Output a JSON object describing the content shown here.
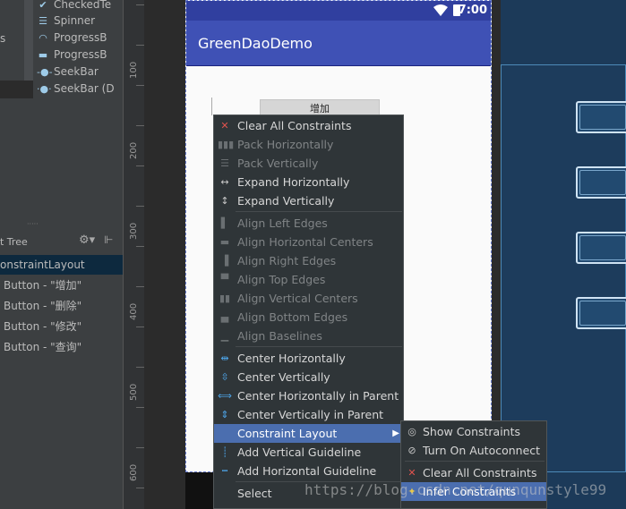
{
  "palette": {
    "items": [
      {
        "icon": "checkbox-icon",
        "label": "CheckedTe"
      },
      {
        "icon": "spinner-icon",
        "label": "Spinner"
      },
      {
        "icon": "progressbar-icon",
        "label": "ProgressB"
      },
      {
        "icon": "progressbar-horizontal-icon",
        "label": "ProgressB"
      },
      {
        "icon": "seekbar-icon",
        "label": "SeekBar"
      },
      {
        "icon": "seekbar-discrete-icon",
        "label": "SeekBar (D"
      }
    ],
    "left_fragment": "s"
  },
  "component_tree": {
    "title": "t Tree",
    "root": "onstraintLayout",
    "children": [
      "Button - \"增加\"",
      "Button - \"删除\"",
      "Button - \"修改\"",
      "Button - \"查询\""
    ]
  },
  "ruler": {
    "labels": [
      "100",
      "200",
      "300",
      "400",
      "500",
      "600"
    ]
  },
  "phone": {
    "time": "7:00",
    "app_title": "GreenDaoDemo",
    "button_fragment": "增加"
  },
  "context_menu": {
    "items": [
      {
        "icon": "clear-constraints-icon",
        "label": "Clear All Constraints",
        "enabled": true
      },
      {
        "icon": "pack-horizontal-icon",
        "label": "Pack Horizontally",
        "enabled": false
      },
      {
        "icon": "pack-vertical-icon",
        "label": "Pack Vertically",
        "enabled": false
      },
      {
        "icon": "expand-horizontal-icon",
        "label": "Expand Horizontally",
        "enabled": true
      },
      {
        "icon": "expand-vertical-icon",
        "label": "Expand Vertically",
        "enabled": true
      },
      {
        "icon": "align-left-icon",
        "label": "Align Left Edges",
        "enabled": false
      },
      {
        "icon": "align-hcenter-icon",
        "label": "Align Horizontal Centers",
        "enabled": false
      },
      {
        "icon": "align-right-icon",
        "label": "Align Right Edges",
        "enabled": false
      },
      {
        "icon": "align-top-icon",
        "label": "Align Top Edges",
        "enabled": false
      },
      {
        "icon": "align-vcenter-icon",
        "label": "Align Vertical Centers",
        "enabled": false
      },
      {
        "icon": "align-bottom-icon",
        "label": "Align Bottom Edges",
        "enabled": false
      },
      {
        "icon": "align-baseline-icon",
        "label": "Align Baselines",
        "enabled": false
      },
      {
        "icon": "center-horizontal-icon",
        "label": "Center Horizontally",
        "enabled": true
      },
      {
        "icon": "center-vertical-icon",
        "label": "Center Vertically",
        "enabled": true
      },
      {
        "icon": "center-horizontal-parent-icon",
        "label": "Center Horizontally in Parent",
        "enabled": true
      },
      {
        "icon": "center-vertical-parent-icon",
        "label": "Center Vertically in Parent",
        "enabled": true
      },
      {
        "icon": "",
        "label": "Constraint Layout",
        "enabled": true,
        "highlighted": true,
        "submenu": true
      },
      {
        "icon": "vertical-guideline-icon",
        "label": "Add Vertical Guideline",
        "enabled": true
      },
      {
        "icon": "horizontal-guideline-icon",
        "label": "Add Horizontal Guideline",
        "enabled": true
      },
      {
        "icon": "",
        "label": "Select",
        "enabled": true
      }
    ]
  },
  "submenu": {
    "items": [
      {
        "icon": "show-constraints-icon",
        "label": "Show Constraints"
      },
      {
        "icon": "autoconnect-icon",
        "label": "Turn On Autoconnect"
      },
      {
        "icon": "clear-constraints-icon",
        "label": "Clear All Constraints"
      },
      {
        "icon": "infer-constraints-icon",
        "label": "Infer Constraints",
        "highlighted": true
      }
    ]
  },
  "watermark": "https://blog.csdn.net/qunqunstyle99",
  "colors": {
    "accent": "#4b6eaf",
    "app_bar": "#3f51b5",
    "status_bar": "#303f9f",
    "blueprint": "#1c3a59"
  }
}
